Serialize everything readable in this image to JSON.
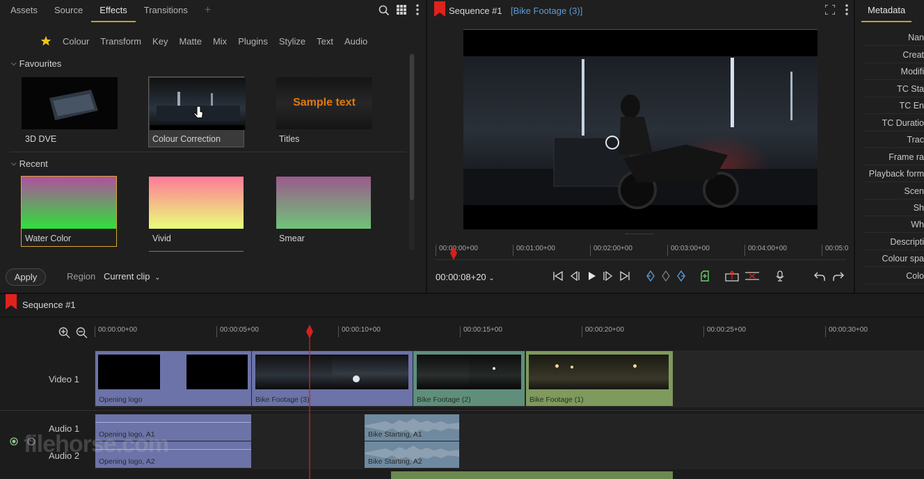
{
  "effects_panel": {
    "tabs": [
      "Assets",
      "Source",
      "Effects",
      "Transitions"
    ],
    "active_tab": "Effects",
    "add_tab": "+",
    "categories": [
      "Colour",
      "Transform",
      "Key",
      "Matte",
      "Mix",
      "Plugins",
      "Stylize",
      "Text",
      "Audio"
    ],
    "favourites_heading": "Favourites",
    "favourites": [
      {
        "label": "3D DVE"
      },
      {
        "label": "Colour Correction"
      },
      {
        "label": "Titles",
        "overlay_text": "Sample text"
      }
    ],
    "recent_heading": "Recent",
    "recent": [
      {
        "label": "Water Color",
        "grad_top": "#b14fa0",
        "grad_bottom": "#2fe03a"
      },
      {
        "label": "Vivid",
        "grad_top": "#ff7a98",
        "grad_bottom": "#e8ff7a"
      },
      {
        "label": "Smear",
        "grad_top": "#9b5a8c",
        "grad_bottom": "#6fc478"
      }
    ],
    "apply_label": "Apply",
    "region_label": "Region",
    "region_value": "Current clip"
  },
  "viewer": {
    "title": "Sequence #1",
    "clip_name": "[Bike Footage (3)]",
    "ruler": [
      "00:00:00+00",
      "00:01:00+00",
      "00:02:00+00",
      "00:03:00+00",
      "00:04:00+00",
      "00:05:0"
    ],
    "timecode": "00:00:08+20",
    "playhead_fraction": 0.02
  },
  "metadata": {
    "tab": "Metadata",
    "fields": [
      "Nan",
      "Creat",
      "Modifi",
      "TC Sta",
      "TC En",
      "TC Duratio",
      "Trac",
      "Frame ra",
      "Playback form",
      "Scen",
      "Sh",
      "Wh",
      "Descripti",
      "Colour spa",
      "Colo"
    ]
  },
  "timeline": {
    "title": "Sequence #1",
    "ruler": [
      "00:00:00+00",
      "00:00:05+00",
      "00:00:10+00",
      "00:00:15+00",
      "00:00:20+00",
      "00:00:25+00",
      "00:00:30+00"
    ],
    "tracks": {
      "video": "Video 1",
      "audio1": "Audio 1",
      "audio2": "Audio 2"
    },
    "video_clips": [
      {
        "name": "Opening logo",
        "color": "#6c73a8"
      },
      {
        "name": "Bike Footage (3)",
        "color": "#6c73a8"
      },
      {
        "name": "Bike Footage (2)",
        "color": "#5f8f7a"
      },
      {
        "name": "Bike Footage (1)",
        "color": "#7e9a5c"
      }
    ],
    "audio_clips": [
      {
        "name": "Opening logo, A1"
      },
      {
        "name": "Opening logo, A2"
      },
      {
        "name": "Bike Starting, A1"
      },
      {
        "name": "Bike Starting, A2"
      }
    ],
    "watermark": "filehorse.com"
  },
  "colors": {
    "accent": "#c9a227",
    "playhead": "#d6201c",
    "link": "#5b9bd5"
  }
}
